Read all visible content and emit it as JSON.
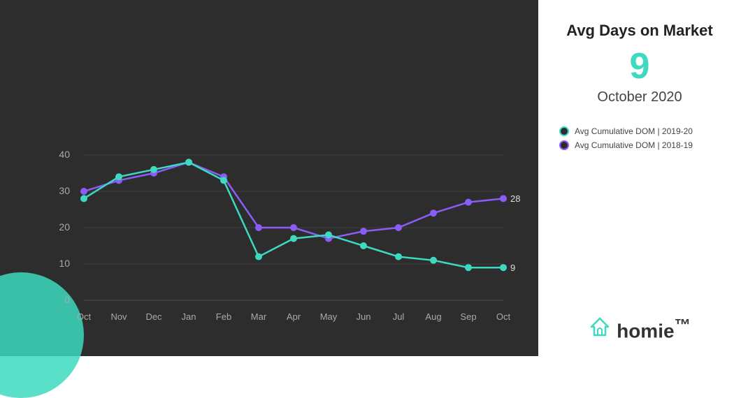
{
  "chart": {
    "title": "Avg Days on Market",
    "big_number": "9",
    "date_label": "October 2020",
    "last_value_teal": "9",
    "last_value_purple": "28",
    "y_labels": [
      "0",
      "10",
      "20",
      "30",
      "40"
    ],
    "x_labels": [
      "Oct",
      "Nov",
      "Dec",
      "Jan",
      "Feb",
      "Mar",
      "Apr",
      "May",
      "Jun",
      "Jul",
      "Aug",
      "Sep",
      "Oct"
    ],
    "legend": [
      {
        "label": "Avg Cumulative DOM | 2019-20",
        "color": "teal"
      },
      {
        "label": "Avg Cumulative DOM | 2018-19",
        "color": "purple"
      }
    ],
    "teal_data": [
      28,
      34,
      36,
      38,
      33,
      12,
      17,
      18,
      15,
      12,
      11,
      9,
      9
    ],
    "purple_data": [
      30,
      33,
      35,
      38,
      34,
      20,
      20,
      17,
      19,
      20,
      24,
      27,
      28
    ]
  },
  "logo": {
    "text": "homie",
    "tm": "™"
  }
}
